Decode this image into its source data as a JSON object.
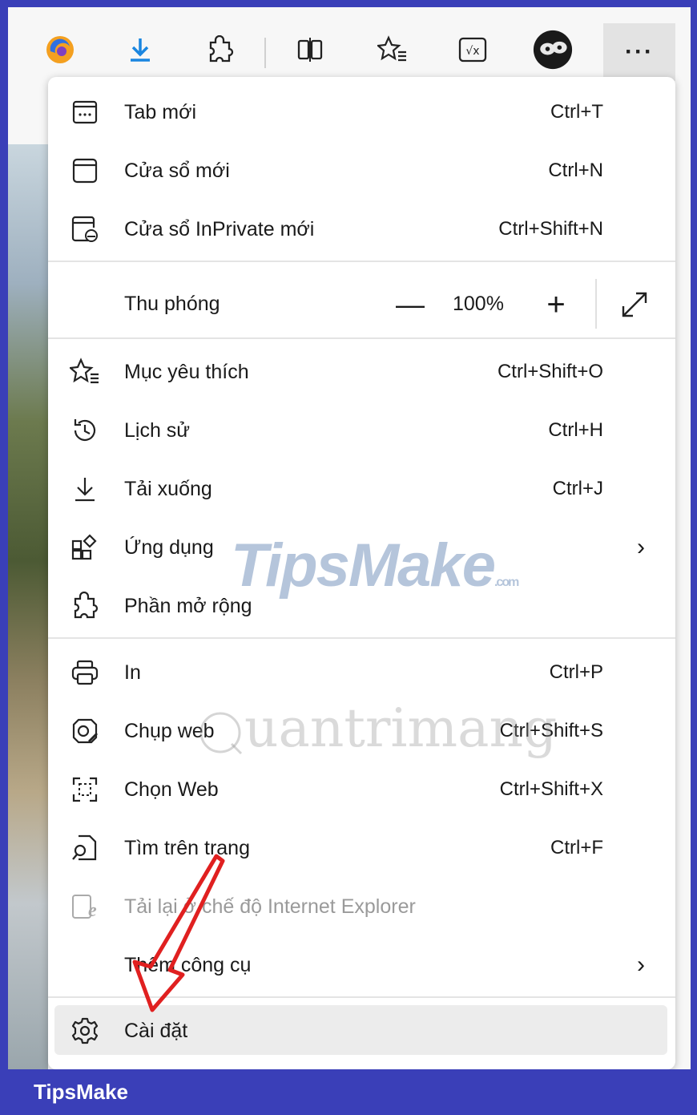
{
  "menu": {
    "items": [
      {
        "label": "Tab mới",
        "shortcut": "Ctrl+T"
      },
      {
        "label": "Cửa sổ mới",
        "shortcut": "Ctrl+N"
      },
      {
        "label": "Cửa sổ InPrivate mới",
        "shortcut": "Ctrl+Shift+N"
      },
      {
        "label": "Mục yêu thích",
        "shortcut": "Ctrl+Shift+O"
      },
      {
        "label": "Lịch sử",
        "shortcut": "Ctrl+H"
      },
      {
        "label": "Tải xuống",
        "shortcut": "Ctrl+J"
      },
      {
        "label": "Ứng dụng",
        "shortcut": ""
      },
      {
        "label": "Phần mở rộng",
        "shortcut": ""
      },
      {
        "label": "In",
        "shortcut": "Ctrl+P"
      },
      {
        "label": "Chụp web",
        "shortcut": "Ctrl+Shift+S"
      },
      {
        "label": "Chọn Web",
        "shortcut": "Ctrl+Shift+X"
      },
      {
        "label": "Tìm trên trang",
        "shortcut": "Ctrl+F"
      },
      {
        "label": "Tải lại ở chế độ Internet Explorer",
        "shortcut": ""
      },
      {
        "label": "Thêm công cụ",
        "shortcut": ""
      },
      {
        "label": "Cài đặt",
        "shortcut": ""
      }
    ],
    "zoom": {
      "label": "Thu phóng",
      "minus": "—",
      "value": "100%",
      "plus": "+"
    }
  },
  "toolbar": {
    "more": "···"
  },
  "watermarks": {
    "tipsmake": "TipsMake",
    "tipsmake_suffix": ".com",
    "quantrimang": "uantrimang"
  },
  "footer": {
    "brand": "TipsMake"
  },
  "colors": {
    "frame": "#3a3fb8",
    "accent_arrow": "#e02020"
  }
}
